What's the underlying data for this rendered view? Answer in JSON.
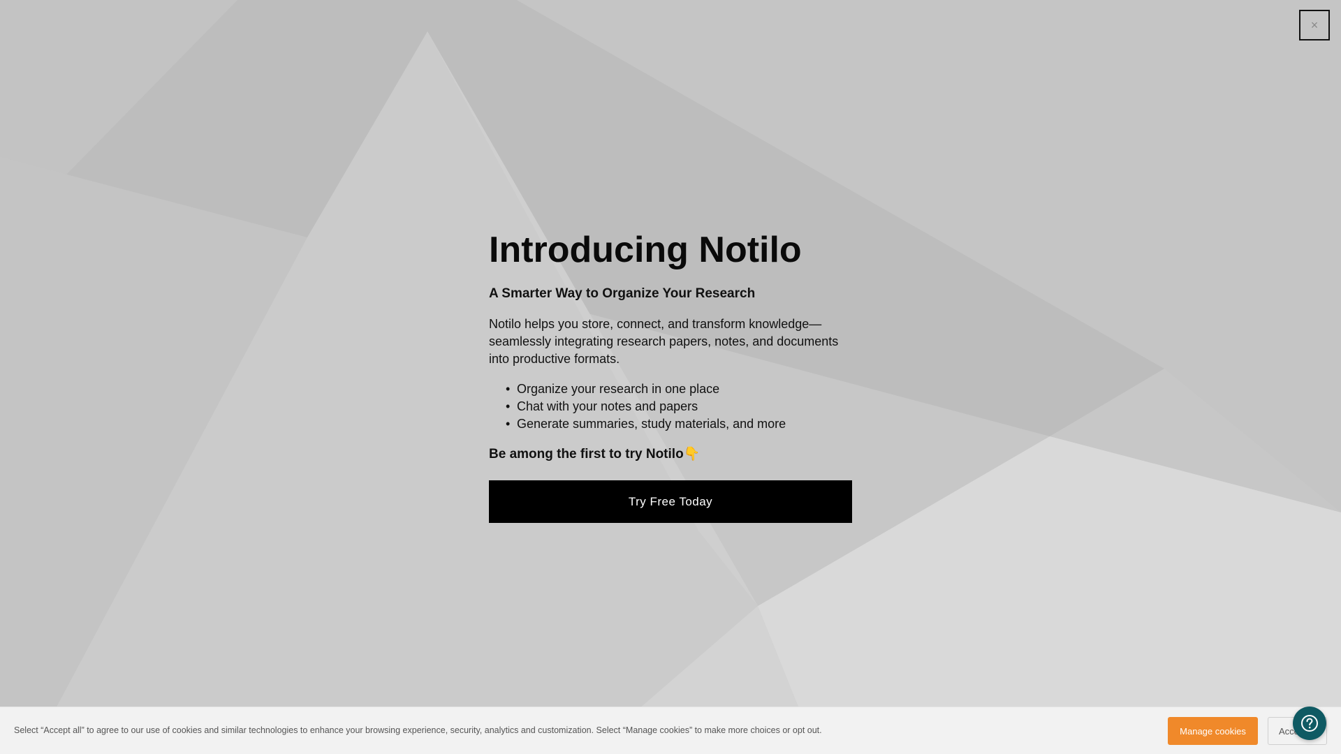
{
  "modal": {
    "close_label": "×",
    "title": "Introducing Notilo",
    "subtitle": "A Smarter Way to Organize Your Research",
    "description": "Notilo helps you store, connect, and transform knowledge—seamlessly integrating research papers, notes, and documents into productive formats.",
    "features": [
      "Organize your research in one place",
      "Chat with your notes and papers",
      "Generate summaries, study materials, and more"
    ],
    "bullet": "•",
    "cta_text": "Be among the first to try Notilo👇",
    "cta_button": "Try Free Today"
  },
  "cookie_banner": {
    "text": "Select “Accept all” to agree to our use of cookies and similar technologies to enhance your browsing experience, security, analytics and customization. Select “Manage cookies” to make more choices or opt out.",
    "manage_label": "Manage cookies",
    "accept_label": "Accept all"
  },
  "help": {
    "icon": "help-circle-icon"
  },
  "colors": {
    "background": "#c7c7c7",
    "cta_background": "#000000",
    "manage_button": "#f0892a",
    "help_button": "#0f5a63"
  }
}
